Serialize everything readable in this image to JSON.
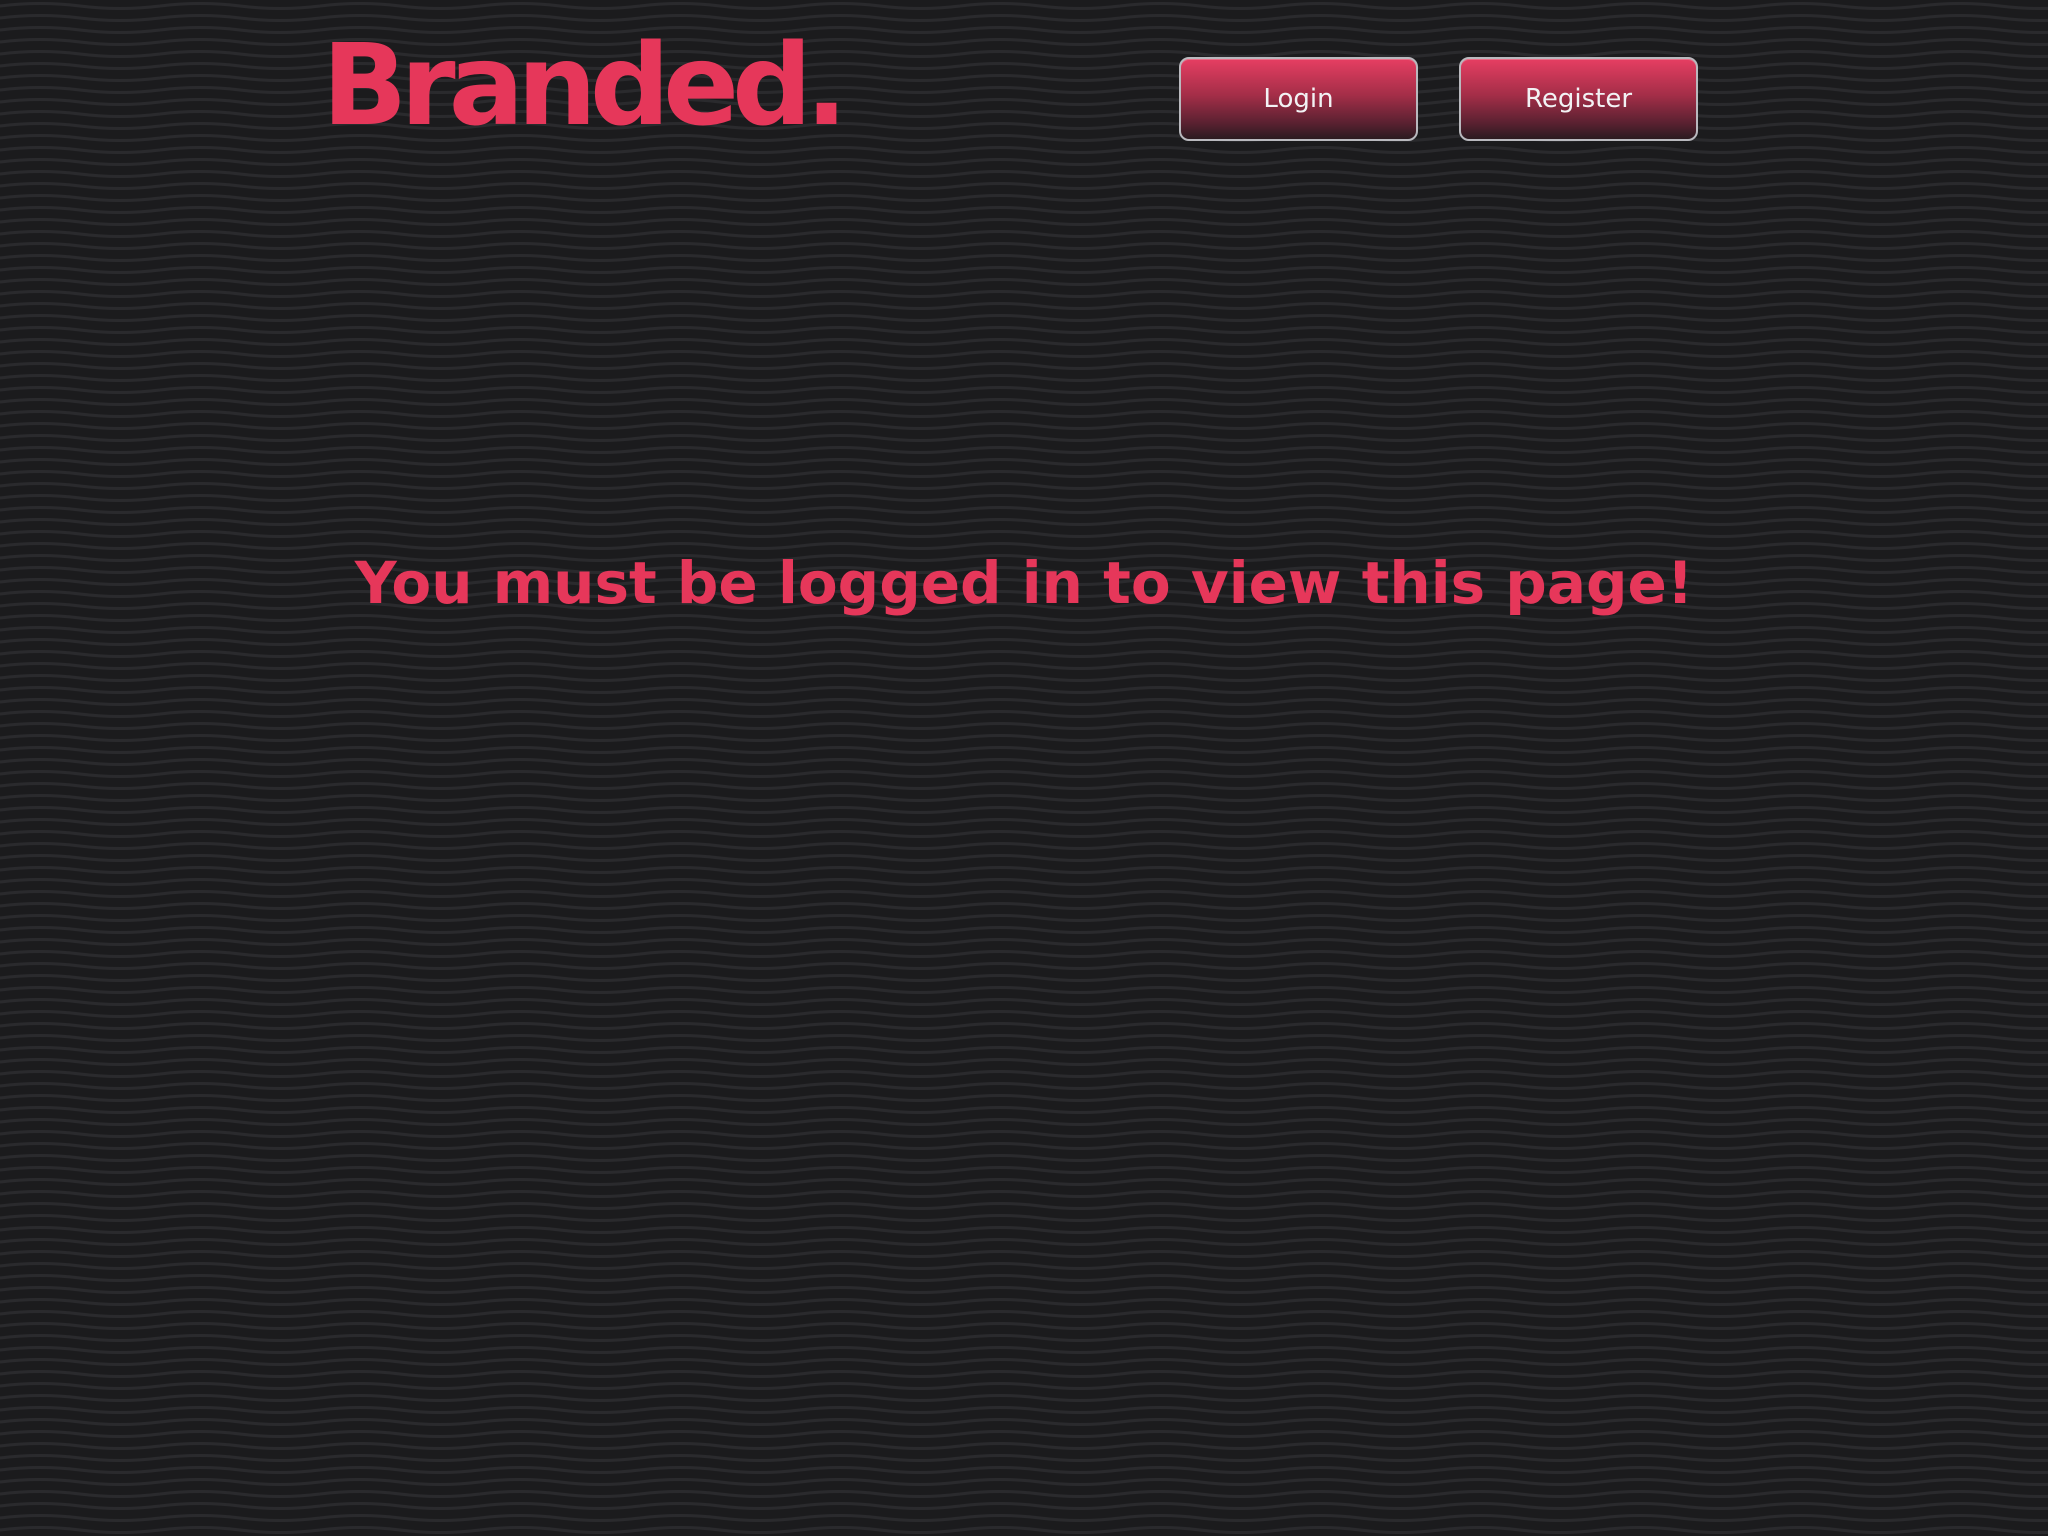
{
  "colors": {
    "background": "#1b1b1d",
    "accent": "#e6375a",
    "button_text": "#f2f2f4"
  },
  "header": {
    "logo_text": "Branded.",
    "login_label": "Login",
    "register_label": "Register"
  },
  "main": {
    "message": "You must be logged in to view this page!"
  }
}
